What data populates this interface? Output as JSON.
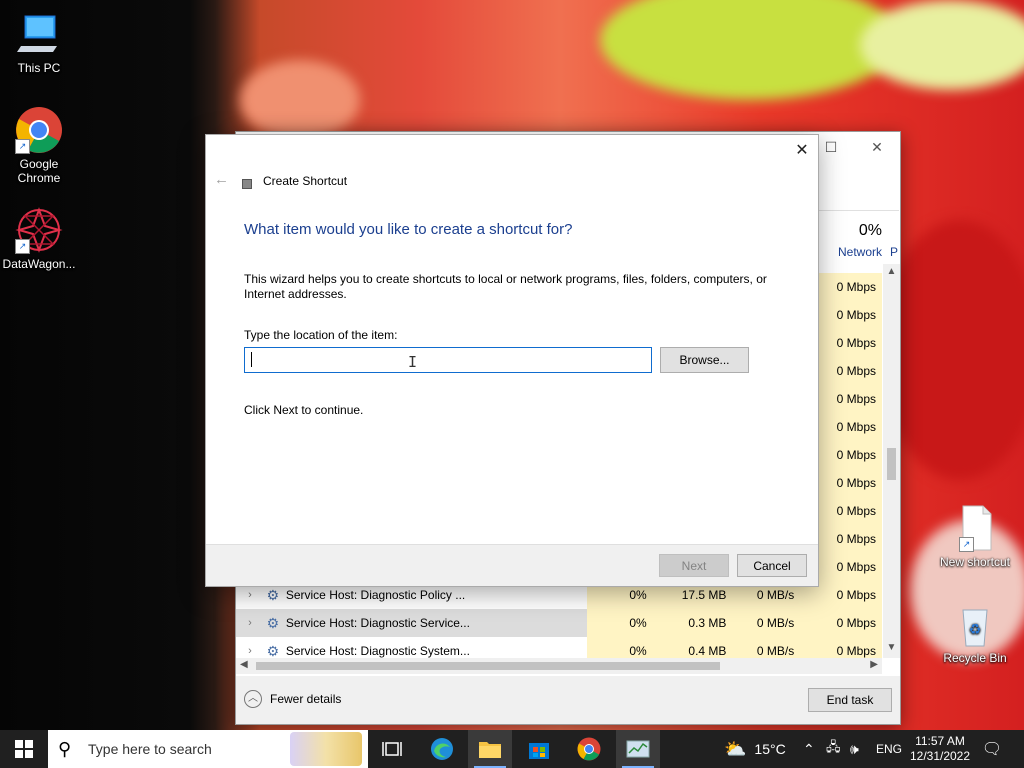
{
  "desktop": {
    "icons": [
      {
        "label": "This PC",
        "icon": "monitor-icon"
      },
      {
        "label": "Google Chrome",
        "icon": "chrome-icon"
      },
      {
        "label": "DataWagon...",
        "icon": "datawagon-icon"
      },
      {
        "label": "New shortcut",
        "icon": "file-shortcut-icon"
      },
      {
        "label": "Recycle Bin",
        "icon": "recycle-bin-icon"
      }
    ]
  },
  "task_manager": {
    "net_header_pct": "0%",
    "net_header_label": "Network",
    "p_col_fragment": "P",
    "net_values": [
      "0 Mbps",
      "0 Mbps",
      "0 Mbps",
      "0 Mbps",
      "0 Mbps",
      "0 Mbps",
      "0 Mbps",
      "0 Mbps",
      "0 Mbps",
      "0 Mbps",
      "0 Mbps"
    ],
    "rows": [
      {
        "name": "Service Host: Diagnostic Policy ...",
        "cpu": "0%",
        "memory": "17.5 MB",
        "disk": "0 MB/s",
        "network": "0 Mbps"
      },
      {
        "name": "Service Host: Diagnostic Service...",
        "cpu": "0%",
        "memory": "0.3 MB",
        "disk": "0 MB/s",
        "network": "0 Mbps"
      },
      {
        "name": "Service Host: Diagnostic System...",
        "cpu": "0%",
        "memory": "0.4 MB",
        "disk": "0 MB/s",
        "network": "0 Mbps"
      }
    ],
    "fewer_details": "Fewer details",
    "end_task": "End task"
  },
  "wizard": {
    "title": "Create Shortcut",
    "heading": "What item would you like to create a shortcut for?",
    "description": "This wizard helps you to create shortcuts to local or network programs, files, folders, computers, or Internet addresses.",
    "location_label": "Type the location of the item:",
    "location_value": "",
    "browse_label": "Browse...",
    "continue_text": "Click Next to continue.",
    "next_label": "Next",
    "cancel_label": "Cancel"
  },
  "taskbar": {
    "search_placeholder": "Type here to search",
    "weather_temp": "15°C",
    "language": "ENG",
    "time": "11:57 AM",
    "date": "12/31/2022"
  }
}
